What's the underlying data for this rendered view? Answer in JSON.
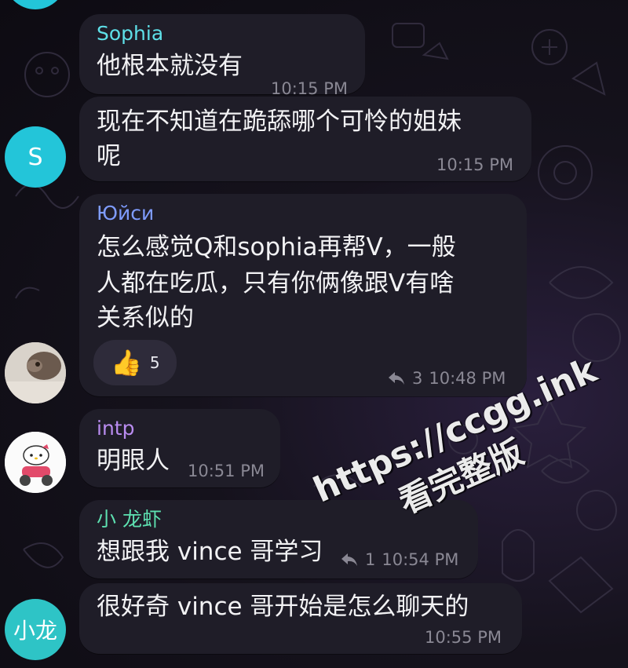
{
  "colors": {
    "bubble": "#1f1d28",
    "sophia_name": "#5ee0e8",
    "yuisi_name": "#7f9cff",
    "intp_name": "#b98cf0",
    "xiaolongxia_name": "#5de0b0",
    "avatar_s": "#23c5d9",
    "avatar_xiaolong": "#2ec4c6"
  },
  "messages": [
    {
      "sender": "Sophia",
      "text": "他根本就没有",
      "time": "10:15 PM"
    },
    {
      "line1": "现在不知道在跪舔哪个可怜的姐妹",
      "line2": "呢",
      "time": "10:15 PM",
      "avatar_letter": "S"
    },
    {
      "sender": "Юйси",
      "line1": "怎么感觉Q和sophia再帮V，一般",
      "line2": "人都在吃瓜，只有你俩像跟V有啥",
      "line3": "关系似的",
      "reaction_emoji": "👍",
      "reaction_count": "5",
      "replies": "3",
      "time": "10:48 PM"
    },
    {
      "sender": "intp",
      "text": "明眼人",
      "time": "10:51 PM"
    },
    {
      "sender": "小 龙虾",
      "text": "想跟我 vince 哥学习",
      "replies": "1",
      "time": "10:54 PM"
    },
    {
      "text": "很好奇 vince 哥开始是怎么聊天的",
      "time": "10:55 PM",
      "avatar_label": "小龙"
    }
  ],
  "watermark": {
    "line1": "https://ccgg.ink",
    "line2": "看完整版"
  }
}
